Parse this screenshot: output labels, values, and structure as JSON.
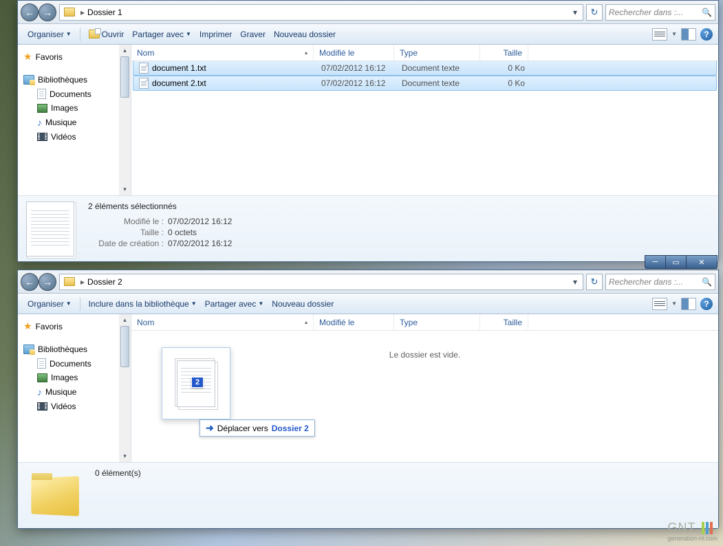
{
  "win1": {
    "breadcrumb": "Dossier 1",
    "search_placeholder": "Rechercher dans :...",
    "toolbar": {
      "organiser": "Organiser",
      "ouvrir": "Ouvrir",
      "partager": "Partager avec",
      "imprimer": "Imprimer",
      "graver": "Graver",
      "nouveau": "Nouveau dossier"
    },
    "sidebar": {
      "favoris": "Favoris",
      "biblio": "Bibliothèques",
      "documents": "Documents",
      "images": "Images",
      "musique": "Musique",
      "videos": "Vidéos"
    },
    "cols": {
      "nom": "Nom",
      "mod": "Modifié le",
      "typ": "Type",
      "tai": "Taille"
    },
    "rows": [
      {
        "name": "document 1.txt",
        "mod": "07/02/2012 16:12",
        "typ": "Document texte",
        "tai": "0 Ko"
      },
      {
        "name": "document 2.txt",
        "mod": "07/02/2012 16:12",
        "typ": "Document texte",
        "tai": "0 Ko"
      }
    ],
    "details": {
      "title": "2 éléments sélectionnés",
      "mod_lbl": "Modifié le :",
      "mod_val": "07/02/2012 16:12",
      "tai_lbl": "Taille :",
      "tai_val": "0 octets",
      "cre_lbl": "Date de création :",
      "cre_val": "07/02/2012 16:12"
    }
  },
  "win2": {
    "breadcrumb": "Dossier 2",
    "search_placeholder": "Rechercher dans :...",
    "toolbar": {
      "organiser": "Organiser",
      "inclure": "Inclure dans la bibliothèque",
      "partager": "Partager avec",
      "nouveau": "Nouveau dossier"
    },
    "sidebar": {
      "favoris": "Favoris",
      "biblio": "Bibliothèques",
      "documents": "Documents",
      "images": "Images",
      "musique": "Musique",
      "videos": "Vidéos"
    },
    "cols": {
      "nom": "Nom",
      "mod": "Modifié le",
      "typ": "Type",
      "tai": "Taille"
    },
    "empty": "Le dossier est vide.",
    "details": {
      "title": "0 élément(s)"
    }
  },
  "drag": {
    "count": "2",
    "tip_prefix": "Déplacer vers ",
    "tip_target": "Dossier 2"
  },
  "watermark": {
    "brand": "GNT",
    "sub": "generation-nt.com"
  }
}
